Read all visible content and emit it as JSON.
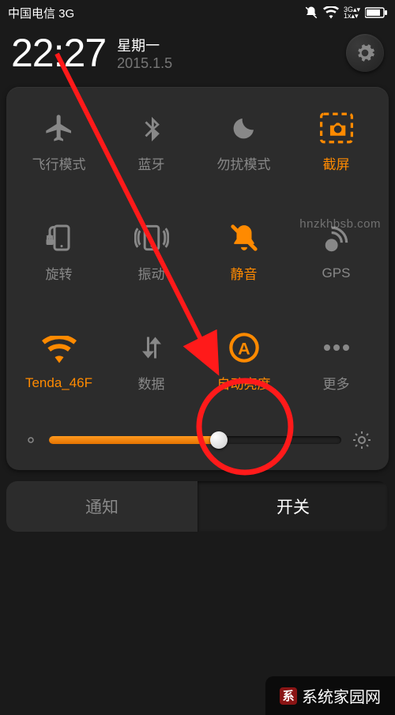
{
  "statusbar": {
    "carrier": "中国电信 3G"
  },
  "header": {
    "time": "22:27",
    "weekday": "星期一",
    "date": "2015.1.5"
  },
  "tiles": {
    "airplane": {
      "label": "飞行模式"
    },
    "bluetooth": {
      "label": "蓝牙"
    },
    "dnd": {
      "label": "勿扰模式"
    },
    "screenshot": {
      "label": "截屏"
    },
    "rotation": {
      "label": "旋转"
    },
    "vibration": {
      "label": "振动"
    },
    "mute": {
      "label": "静音"
    },
    "gps": {
      "label": "GPS"
    },
    "wifi": {
      "label": "Tenda_46F"
    },
    "mobiledata": {
      "label": "数据"
    },
    "autobright": {
      "label": "自动亮度"
    },
    "more": {
      "label": "更多"
    }
  },
  "colors": {
    "accent": "#ff8a00",
    "inactive": "#888888"
  },
  "slider": {
    "value_percent": 58
  },
  "tabs": {
    "notifications": "通知",
    "toggles": "开关"
  },
  "watermark_text": "hnzkhbsb.com",
  "footer_brand": "系统家园网"
}
